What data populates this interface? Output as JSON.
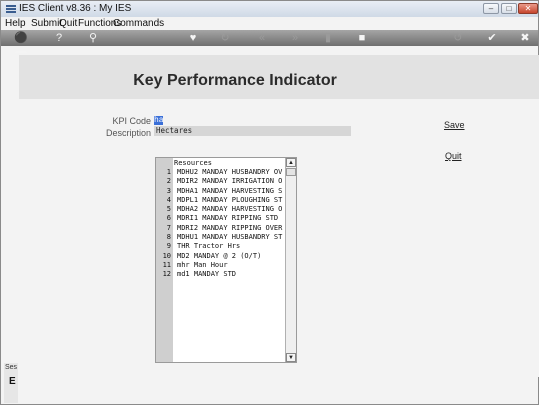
{
  "window": {
    "title": "IES Client v8.36 : My IES"
  },
  "menu": [
    "Help",
    "Submit",
    "Quit",
    "Functions",
    "Commands"
  ],
  "toolbar_icons": [
    "key-icon",
    "help-icon",
    "search-icon",
    "heart-icon",
    "refresh-icon",
    "rewind-icon",
    "fast-forward-icon",
    "bookmark-icon",
    "stop-icon",
    "back-icon",
    "check-icon",
    "close-icon"
  ],
  "heading": "Key Performance Indicator",
  "form": {
    "kpi_code_label": "KPI Code",
    "kpi_code_value": "ha",
    "description_label": "Description",
    "description_value": "Hectares"
  },
  "actions": {
    "save": "Save",
    "quit": "Quit"
  },
  "resources": {
    "header": "Resources",
    "rows": [
      {
        "num": "1",
        "text": "MDHU2 MANDAY HUSBANDRY OV"
      },
      {
        "num": "2",
        "text": "MDIR2 MANDAY IRRIGATION O"
      },
      {
        "num": "3",
        "text": "MDHA1 MANDAY HARVESTING S"
      },
      {
        "num": "4",
        "text": "MDPL1 MANDAY PLOUGHING ST"
      },
      {
        "num": "5",
        "text": "MDHA2 MANDAY HARVESTING O"
      },
      {
        "num": "6",
        "text": "MDRI1 MANDAY RIPPING STD"
      },
      {
        "num": "7",
        "text": "MDRI2 MANDAY RIPPING OVER"
      },
      {
        "num": "8",
        "text": "MDHU1 MANDAY HUSBANDRY ST"
      },
      {
        "num": "9",
        "text": "THR Tractor Hrs"
      },
      {
        "num": "10",
        "text": "MD2 MANDAY @ 2 (O/T)"
      },
      {
        "num": "11",
        "text": "mhr Man Hour"
      },
      {
        "num": "12",
        "text": "md1 MANDAY STD"
      }
    ]
  },
  "left_panel": {
    "text": "Ses",
    "glyph": "E"
  },
  "colors": {
    "accent": "#3a6fd8",
    "toolbar": "#8a8a8a",
    "header_band": "#e2e2e2"
  }
}
